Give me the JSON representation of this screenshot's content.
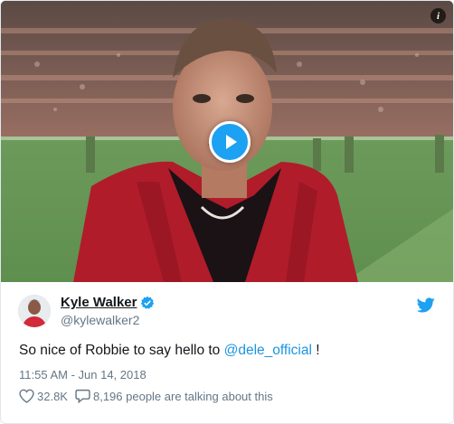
{
  "media": {
    "info_label": "i",
    "play_icon": "play-icon",
    "info_icon": "info-icon"
  },
  "author": {
    "display_name": "Kyle Walker",
    "handle": "@kylewalker2",
    "verified_icon": "verified-badge-icon",
    "platform_icon": "twitter-bird-icon"
  },
  "tweet": {
    "text_before": "So nice of Robbie to say hello to ",
    "mention": "@dele_official",
    "text_after": " !",
    "timestamp": "11:55 AM - Jun 14, 2018"
  },
  "actions": {
    "likes": "32.8K",
    "talking": "8,196 people are talking about this",
    "like_icon": "heart-icon",
    "reply_icon": "speech-bubble-icon"
  },
  "colors": {
    "accent": "#1da1f2",
    "link": "#1b95e0",
    "muted": "#657786",
    "text": "#14171a",
    "jacket": "#b01c2a"
  }
}
